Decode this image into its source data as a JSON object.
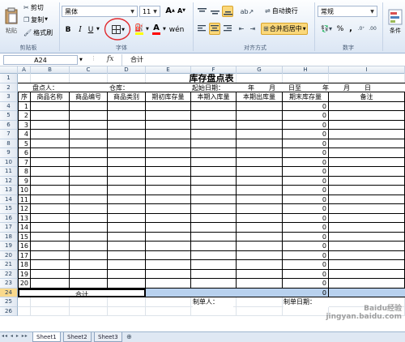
{
  "ribbon": {
    "paste_label": "粘贴",
    "cut_label": "剪切",
    "copy_label": "复制",
    "format_painter_label": "格式刷",
    "clipboard_group": "剪贴板",
    "font_name": "黑体",
    "font_size": "11",
    "font_group": "字体",
    "bold": "B",
    "italic": "I",
    "underline": "U",
    "grow_font": "A",
    "shrink_font": "A",
    "align_group": "对齐方式",
    "wrap_text_label": "自动换行",
    "merge_center_label": "合并后居中",
    "number_format": "常规",
    "number_group": "数字",
    "conditional_format_label": "条件",
    "percent": "%",
    "comma": ",",
    "underline_color": "#ff0000",
    "fill_color": "#ffff00",
    "font_color": "#ff0000"
  },
  "formula_bar": {
    "name_box": "A24",
    "fx": "fx",
    "content": "合计"
  },
  "columns": [
    "A",
    "B",
    "C",
    "D",
    "E",
    "F",
    "G",
    "H",
    "I"
  ],
  "sheet": {
    "title": "库存盘点表",
    "row2": {
      "counter_label": "盘点人：",
      "warehouse_label": "仓库：",
      "start_date_label": "起始日期：",
      "year1": "年",
      "month1": "月",
      "day_to": "日至",
      "year2": "年",
      "month2": "月",
      "day2": "日"
    },
    "headers": [
      "序",
      "商品名称",
      "商品编号",
      "商品类别",
      "期初库存量",
      "本期入库量",
      "本期出库量",
      "期末库存量",
      "备注"
    ],
    "row_numbers": [
      "1",
      "2",
      "3",
      "4",
      "5",
      "6",
      "7",
      "8",
      "9",
      "10",
      "11",
      "12",
      "13",
      "14",
      "15",
      "16",
      "17",
      "18",
      "19",
      "20"
    ],
    "ending_values": [
      "0",
      "0",
      "0",
      "0",
      "0",
      "0",
      "0",
      "0",
      "0",
      "0",
      "0",
      "0",
      "0",
      "0",
      "0",
      "0",
      "0",
      "0",
      "0",
      "0"
    ],
    "total_label": "合计",
    "total_value": "0",
    "maker_label": "制单人：",
    "make_date_label": "制单日期："
  },
  "sheet_rows": [
    "1",
    "2",
    "3",
    "4",
    "5",
    "6",
    "7",
    "8",
    "9",
    "10",
    "11",
    "12",
    "13",
    "14",
    "15",
    "16",
    "17",
    "18",
    "19",
    "20",
    "21",
    "22",
    "23",
    "24",
    "25",
    "26"
  ],
  "tabs": [
    "Sheet1",
    "Sheet2",
    "Sheet3"
  ],
  "watermark": "Baidu经验 jingyan.baidu.com"
}
